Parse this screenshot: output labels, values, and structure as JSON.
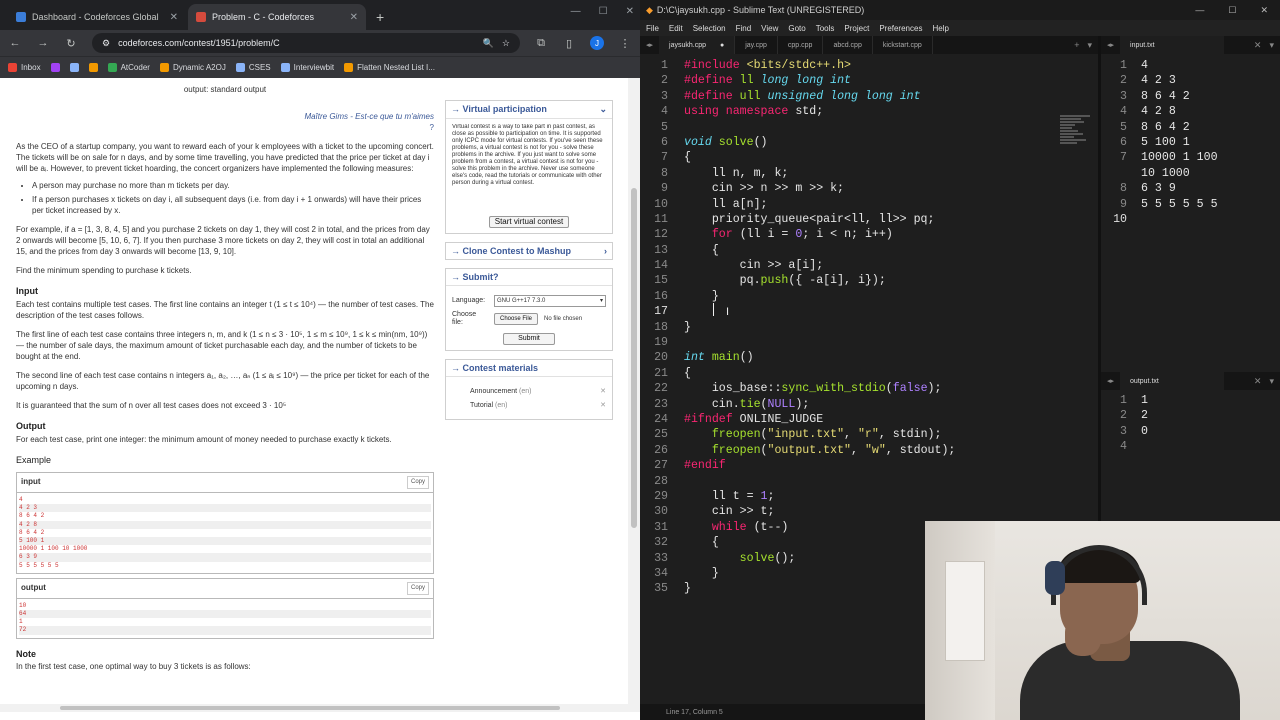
{
  "browser": {
    "tabs": [
      {
        "title": "Dashboard - Codeforces Global",
        "close": "✕",
        "active": false
      },
      {
        "title": "Problem - C - Codeforces",
        "close": "✕",
        "active": true
      }
    ],
    "new_tab": "+",
    "url": "codeforces.com/contest/1951/problem/C",
    "bookmarks": [
      "Inbox",
      "AtCoder",
      "Dynamic A2OJ",
      "CSES",
      "Interviewbit",
      "Flatten Nested List I..."
    ]
  },
  "problem": {
    "output_spec": "output: standard output",
    "signature": "Maître Gims - Est-ce que tu m'aimes",
    "signature_q": "?",
    "p1": "As the CEO of a startup company, you want to reward each of your k employees with a ticket to the upcoming concert. The tickets will be on sale for n days, and by some time travelling, you have predicted that the price per ticket at day i will be aᵢ. However, to prevent ticket hoarding, the concert organizers have implemented the following measures:",
    "bullets": [
      "A person may purchase no more than m tickets per day.",
      "If a person purchases x tickets on day i, all subsequent days (i.e. from day i + 1 onwards) will have their prices per ticket increased by x."
    ],
    "p2": "For example, if a = [1, 3, 8, 4, 5] and you purchase 2 tickets on day 1, they will cost 2 in total, and the prices from day 2 onwards will become [5, 10, 6, 7]. If you then purchase 3 more tickets on day 2, they will cost in total an additional 15, and the prices from day 3 onwards will become [13, 9, 10].",
    "p3": "Find the minimum spending to purchase k tickets.",
    "input_title": "Input",
    "input_p1": "Each test contains multiple test cases. The first line contains an integer t (1 ≤ t ≤ 10⁴) — the number of test cases. The description of the test cases follows.",
    "input_p2": "The first line of each test case contains three integers n, m, and k (1 ≤ n ≤ 3 · 10⁵, 1 ≤ m ≤ 10⁹, 1 ≤ k ≤ min(nm, 10⁹)) — the number of sale days, the maximum amount of ticket purchasable each day, and the number of tickets to be bought at the end.",
    "input_p3": "The second line of each test case contains n integers a₁, a₂, …, aₙ (1 ≤ aᵢ ≤ 10⁹) — the price per ticket for each of the upcoming n days.",
    "input_p4": "It is guaranteed that the sum of n over all test cases does not exceed 3 · 10⁵",
    "output_title": "Output",
    "output_p": "For each test case, print one integer: the minimum amount of money needed to purchase exactly k tickets.",
    "example_title": "Example",
    "sample_input_label": "input",
    "sample_output_label": "output",
    "copy": "Copy",
    "sample_input": [
      "4",
      "4 2 3",
      "8 6 4 2",
      "4 2 8",
      "8 6 4 2",
      "5 100 1",
      "10000 1 100 10 1000",
      "6 3 9",
      "5 5 5 5 5 5"
    ],
    "sample_output": [
      "10",
      "64",
      "1",
      "72"
    ],
    "note_title": "Note",
    "note_p": "In the first test case, one optimal way to buy 3 tickets is as follows:"
  },
  "sidebar": {
    "virtual_title": "→ Virtual participation",
    "virtual_text": "Virtual contest is a way to take part in past contest, as close as possible to participation on time. It is supported only ICPC mode for virtual contests. If you've seen these problems, a virtual contest is not for you - solve these problems in the archive. If you just want to solve some problem from a contest, a virtual contest is not for you - solve this problem in the archive. Never use someone else's code, read the tutorials or communicate with other person during a virtual contest.",
    "virtual_button": "Start virtual contest",
    "clone_title": "→ Clone Contest to Mashup",
    "submit_title": "→ Submit?",
    "language_label": "Language:",
    "language_value": "GNU G++17 7.3.0",
    "choose_label": "Choose file:",
    "choose_button": "Choose File",
    "no_file": "No file chosen",
    "submit_button": "Submit",
    "materials_title": "→ Contest materials",
    "materials": [
      {
        "name": "Announcement",
        "lang": "(en)"
      },
      {
        "name": "Tutorial",
        "lang": "(en)"
      }
    ]
  },
  "sublime": {
    "title": "D:\\C\\jaysukh.cpp - Sublime Text (UNREGISTERED)",
    "menu": [
      "File",
      "Edit",
      "Selection",
      "Find",
      "View",
      "Goto",
      "Tools",
      "Project",
      "Preferences",
      "Help"
    ],
    "tabs": [
      "jaysukh.cpp",
      "jay.cpp",
      "cpp.cpp",
      "abcd.cpp",
      "kickstart.cpp"
    ],
    "input_tab": "input.txt",
    "output_tab": "output.txt",
    "status": "Line 17, Column 5",
    "input_lines": [
      "4",
      "4 2 3",
      "8 6 4 2",
      "4 2 8",
      "8 6 4 2",
      "5 100 1",
      "10000 1 100",
      "10 1000",
      "6 3 9",
      "5 5 5 5 5 5",
      ""
    ],
    "input_line_nums": [
      "1",
      "2",
      "3",
      "4",
      "5",
      "6",
      "7",
      "",
      "8",
      "9",
      "10"
    ],
    "output_lines": [
      "1",
      "2",
      "0",
      ""
    ],
    "code": [
      [
        [
          "pp",
          "#include "
        ],
        [
          "st",
          "<bits/stdc++.h>"
        ]
      ],
      [
        [
          "pp",
          "#define "
        ],
        [
          "fn",
          "ll "
        ],
        [
          "ty",
          "long long int"
        ]
      ],
      [
        [
          "pp",
          "#define "
        ],
        [
          "fn",
          "ull "
        ],
        [
          "ty",
          "unsigned long long int"
        ]
      ],
      [
        [
          "kw",
          "using namespace "
        ],
        [
          "txt",
          "std;"
        ]
      ],
      [],
      [
        [
          "ty",
          "void "
        ],
        [
          "fn",
          "solve"
        ],
        [
          "txt",
          "()"
        ]
      ],
      [
        [
          "txt",
          "{"
        ]
      ],
      [
        [
          "txt",
          "    ll n, m, k;"
        ]
      ],
      [
        [
          "txt",
          "    cin >> n >> m >> k;"
        ]
      ],
      [
        [
          "txt",
          "    ll a[n];"
        ]
      ],
      [
        [
          "txt",
          "    priority_queue<pair<ll, ll>> pq;"
        ]
      ],
      [
        [
          "txt",
          "    "
        ],
        [
          "kw",
          "for "
        ],
        [
          "txt",
          "(ll i = "
        ],
        [
          "nu",
          "0"
        ],
        [
          "txt",
          "; i < n; i++)"
        ]
      ],
      [
        [
          "txt",
          "    {"
        ]
      ],
      [
        [
          "txt",
          "        cin >> a[i];"
        ]
      ],
      [
        [
          "txt",
          "        pq."
        ],
        [
          "fn",
          "push"
        ],
        [
          "txt",
          "({ -a[i], i});"
        ]
      ],
      [
        [
          "txt",
          "    }"
        ]
      ],
      [
        [
          "txt",
          "    "
        ]
      ],
      [
        [
          "txt",
          "}"
        ]
      ],
      [],
      [
        [
          "ty",
          "int "
        ],
        [
          "fn",
          "main"
        ],
        [
          "txt",
          "()"
        ]
      ],
      [
        [
          "txt",
          "{"
        ]
      ],
      [
        [
          "txt",
          "    ios_base::"
        ],
        [
          "fn",
          "sync_with_stdio"
        ],
        [
          "txt",
          "("
        ],
        [
          "nu",
          "false"
        ],
        [
          "txt",
          ");"
        ]
      ],
      [
        [
          "txt",
          "    cin."
        ],
        [
          "fn",
          "tie"
        ],
        [
          "txt",
          "("
        ],
        [
          "nu",
          "NULL"
        ],
        [
          "txt",
          ");"
        ]
      ],
      [
        [
          "pp",
          "#ifndef "
        ],
        [
          "txt",
          "ONLINE_JUDGE"
        ]
      ],
      [
        [
          "txt",
          "    "
        ],
        [
          "fn",
          "freopen"
        ],
        [
          "txt",
          "("
        ],
        [
          "st",
          "\"input.txt\""
        ],
        [
          "txt",
          ", "
        ],
        [
          "st",
          "\"r\""
        ],
        [
          "txt",
          ", stdin);"
        ]
      ],
      [
        [
          "txt",
          "    "
        ],
        [
          "fn",
          "freopen"
        ],
        [
          "txt",
          "("
        ],
        [
          "st",
          "\"output.txt\""
        ],
        [
          "txt",
          ", "
        ],
        [
          "st",
          "\"w\""
        ],
        [
          "txt",
          ", stdout);"
        ]
      ],
      [
        [
          "pp",
          "#endif"
        ]
      ],
      [],
      [
        [
          "txt",
          "    ll t = "
        ],
        [
          "nu",
          "1"
        ],
        [
          "txt",
          ";"
        ]
      ],
      [
        [
          "txt",
          "    cin >> t;"
        ]
      ],
      [
        [
          "txt",
          "    "
        ],
        [
          "kw",
          "while "
        ],
        [
          "txt",
          "(t--)"
        ]
      ],
      [
        [
          "txt",
          "    {"
        ]
      ],
      [
        [
          "txt",
          "        "
        ],
        [
          "fn",
          "solve"
        ],
        [
          "txt",
          "();"
        ]
      ],
      [
        [
          "txt",
          "    }"
        ]
      ],
      [
        [
          "txt",
          "}"
        ]
      ]
    ]
  },
  "colors": {
    "cf_link": "#3b5998",
    "sample_text": "#cc3333",
    "monokai_keyword": "#f92672",
    "monokai_string": "#e6db74",
    "monokai_type": "#66d9ef",
    "monokai_func": "#a6e22e"
  }
}
